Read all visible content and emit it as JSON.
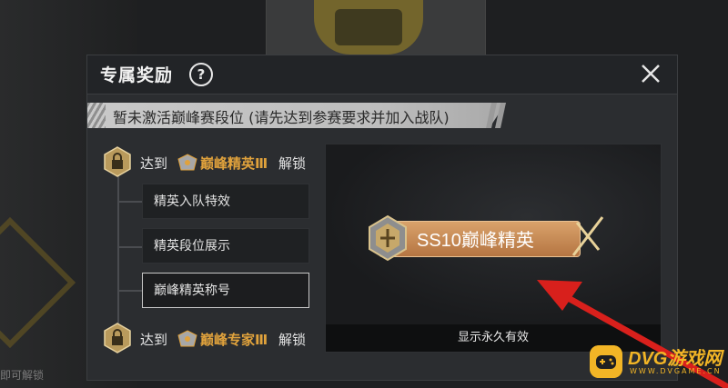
{
  "dialog": {
    "title": "专属奖励",
    "help_symbol": "?",
    "banner_text": "暂未激活巅峰赛段位 (请先达到参赛要求并加入战队)"
  },
  "requirements": [
    {
      "prefix": "达到",
      "rank": "巅峰精英Ⅲ",
      "suffix": "解锁"
    },
    {
      "prefix": "达到",
      "rank": "巅峰专家Ⅲ",
      "suffix": "解锁"
    }
  ],
  "rewards": [
    {
      "label": "精英入队特效",
      "selected": false
    },
    {
      "label": "精英段位展示",
      "selected": false
    },
    {
      "label": "巅峰精英称号",
      "selected": true
    }
  ],
  "preview": {
    "title_text": "SS10巅峰精英",
    "caption": "显示永久有效"
  },
  "background": {
    "bottom_text": "即可解锁"
  },
  "watermark": {
    "main": "DVG游戏网",
    "sub": "WWW.DVGAME.CN"
  },
  "colors": {
    "rank_text": "#e0a23c",
    "title_plate": "#c98a52",
    "arrow": "#d8201c",
    "watermark": "#f2b526"
  }
}
